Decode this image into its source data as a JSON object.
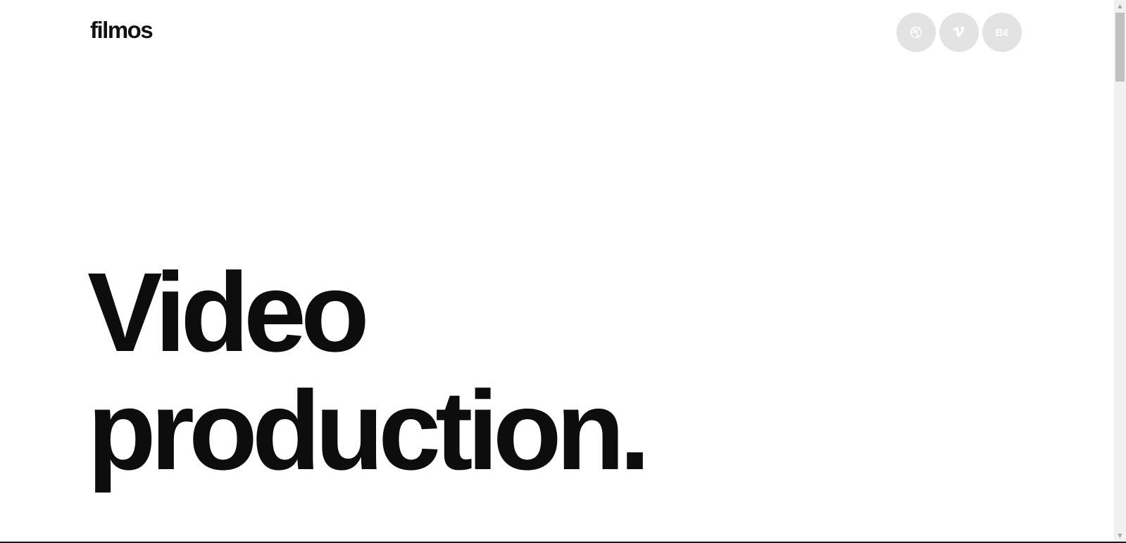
{
  "header": {
    "logo_text": "filmos",
    "socials": [
      {
        "icon": "dribbble-icon",
        "label": ""
      },
      {
        "icon": "vimeo-icon",
        "label": ""
      },
      {
        "icon": "behance-icon",
        "label": "Bē"
      }
    ]
  },
  "hero": {
    "line1": "Video",
    "line2": "production."
  },
  "colors": {
    "text": "#0d0d0d",
    "social_bg": "#e3e3e3",
    "social_fg": "#ffffff"
  }
}
